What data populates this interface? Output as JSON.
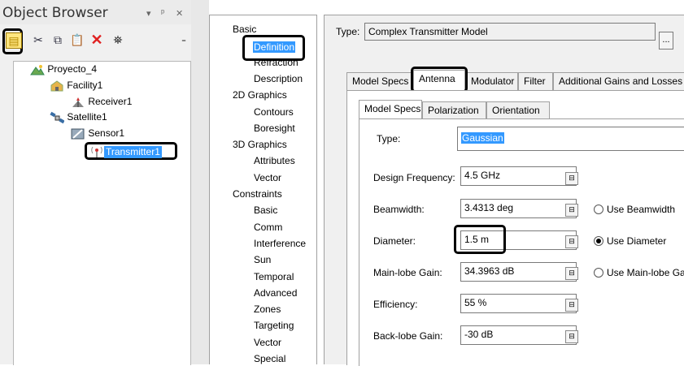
{
  "object_browser": {
    "title": "Object Browser",
    "title_buttons": [
      "▾",
      "ᵖ",
      "✕"
    ],
    "toolbar": [
      {
        "icon": "properties-icon",
        "glyph": "▤"
      },
      {
        "icon": "cut-icon",
        "glyph": "✂"
      },
      {
        "icon": "copy-icon",
        "glyph": "⧉"
      },
      {
        "icon": "paste-icon",
        "glyph": "📋"
      },
      {
        "icon": "delete-icon",
        "glyph": "✕"
      },
      {
        "icon": "find-icon",
        "glyph": "⛯"
      },
      {
        "icon": "overflow-icon",
        "glyph": "₌"
      }
    ],
    "tree": [
      {
        "label": "Proyecto_4",
        "icon": "scenario-icon"
      },
      {
        "label": "Facility1",
        "icon": "facility-icon"
      },
      {
        "label": "Receiver1",
        "icon": "receiver-icon"
      },
      {
        "label": "Satellite1",
        "icon": "satellite-icon"
      },
      {
        "label": "Sensor1",
        "icon": "sensor-icon"
      },
      {
        "label": "Transmitter1",
        "icon": "transmitter-icon"
      }
    ]
  },
  "pages": [
    "Basic",
    "Definition",
    "Refraction",
    "Description",
    "2D Graphics",
    "Contours",
    "Boresight",
    "3D Graphics",
    "Attributes",
    "Vector",
    "Constraints",
    "Basic",
    "Comm",
    "Interference",
    "Sun",
    "Temporal",
    "Advanced",
    "Zones",
    "Targeting",
    "Vector",
    "Special"
  ],
  "main": {
    "type_label": "Type:",
    "type_value": "Complex Transmitter Model",
    "type_button": "...",
    "tabs": [
      "Model Specs",
      "Antenna",
      "Modulator",
      "Filter",
      "Additional Gains and Losses"
    ],
    "subtabs": [
      "Model Specs",
      "Polarization",
      "Orientation"
    ],
    "antenna_type_label": "Type:",
    "antenna_type_value": "Gaussian",
    "fields": [
      {
        "label": "Design Frequency:",
        "value": "4.5 GHz",
        "radio": ""
      },
      {
        "label": "Beamwidth:",
        "value": "3.4313 deg",
        "radio": "Use Beamwidth"
      },
      {
        "label": "Diameter:",
        "value": "1.5 m",
        "radio": "Use Diameter"
      },
      {
        "label": "Main-lobe Gain:",
        "value": "34.3963 dB",
        "radio": "Use Main-lobe Ga"
      },
      {
        "label": "Efficiency:",
        "value": "55 %",
        "radio": ""
      },
      {
        "label": "Back-lobe Gain:",
        "value": "-30 dB",
        "radio": ""
      }
    ],
    "selected_radio": "Use Diameter"
  }
}
